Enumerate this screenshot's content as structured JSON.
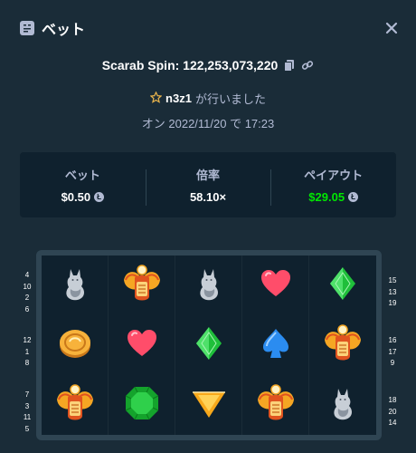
{
  "header": {
    "title": "ベット",
    "header_icon": "bet-slip-icon",
    "close_icon": "close-icon"
  },
  "spin": {
    "text": "Scarab Spin: 122,253,073,220",
    "copy_icon": "copy-icon",
    "link_icon": "link-icon"
  },
  "user": {
    "star_icon": "star-icon",
    "name": "n3z1",
    "suffix": "が行いました"
  },
  "date": {
    "text": "オン 2022/11/20 で 17:23"
  },
  "stats": {
    "bet_label": "ベット",
    "bet_value": "$0.50",
    "multiplier_label": "倍率",
    "multiplier_value": "58.10×",
    "payout_label": "ペイアウト",
    "payout_value": "$29.05",
    "coin_icon": "litecoin-icon",
    "payout_color": "#00e701"
  },
  "board": {
    "rows": [
      [
        "cat-statue",
        "scarab",
        "cat-statue",
        "heart",
        "green-diamond"
      ],
      [
        "gold-coin",
        "heart",
        "green-diamond",
        "spade",
        "scarab"
      ],
      [
        "scarab",
        "emerald",
        "gold-triangle",
        "scarab",
        "cat-statue"
      ]
    ],
    "left_numbers": [
      [
        "4",
        "10",
        "2",
        "6"
      ],
      [
        "12",
        "1",
        "8"
      ],
      [
        "7",
        "3",
        "11",
        "5"
      ]
    ],
    "right_numbers": [
      [
        "15",
        "13",
        "19"
      ],
      [
        "16",
        "17",
        "9"
      ],
      [
        "18",
        "20",
        "14"
      ]
    ]
  }
}
